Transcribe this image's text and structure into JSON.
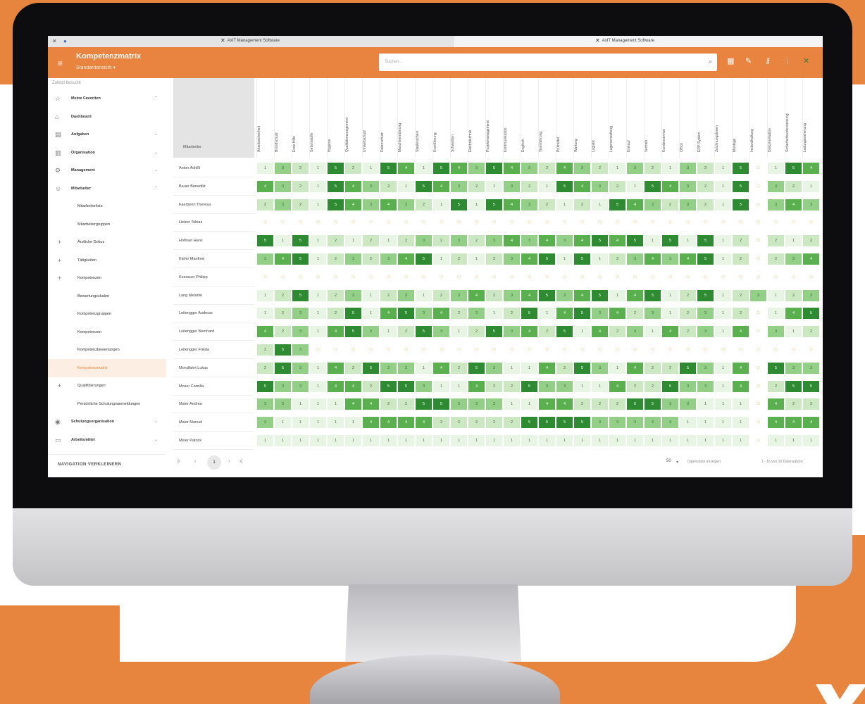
{
  "window": {
    "tab_left_title": "AxIT Management Software",
    "tab_right_title": "AxIT Management Software"
  },
  "appbar": {
    "title": "Kompetenzmatrix",
    "subtitle": "Standardansicht ▾",
    "search_placeholder": "Suchen..."
  },
  "sidebar": {
    "search_label": "Zuletzt besucht",
    "items": [
      {
        "label": "Meine Favoriten",
        "icon": "star-icon",
        "chevron": "⌃"
      },
      {
        "label": "Dashboard",
        "icon": "home-icon",
        "chevron": ""
      },
      {
        "label": "Aufgaben",
        "icon": "clipboard-icon",
        "chevron": "⌄"
      },
      {
        "label": "Organisation",
        "icon": "building-icon",
        "chevron": "⌄"
      },
      {
        "label": "Management",
        "icon": "settings-icon",
        "chevron": "⌄"
      },
      {
        "label": "Mitarbeiter",
        "icon": "person-icon",
        "chevron": "⌃"
      },
      {
        "label": "Mitarbeiterliste",
        "icon": "",
        "chevron": ""
      },
      {
        "label": "Mitarbeitergruppen",
        "icon": "",
        "chevron": ""
      },
      {
        "label": "Ärztliche Dokus",
        "icon": "",
        "chevron": ""
      },
      {
        "label": "Tätigkeiten",
        "icon": "",
        "chevron": ""
      },
      {
        "label": "Kompetenzen",
        "icon": "",
        "chevron": ""
      },
      {
        "label": "Bewertungsskalen",
        "icon": "",
        "chevron": ""
      },
      {
        "label": "Kompetenzgruppen",
        "icon": "",
        "chevron": ""
      },
      {
        "label": "Kompetenzen",
        "icon": "",
        "chevron": ""
      },
      {
        "label": "Kompetenzbewertungen",
        "icon": "",
        "chevron": ""
      },
      {
        "label": "Kompetenzmatrix",
        "icon": "",
        "chevron": ""
      },
      {
        "label": "Qualifizierungen",
        "icon": "",
        "chevron": ""
      },
      {
        "label": "Persönliche Schulungsanmeldungen",
        "icon": "",
        "chevron": ""
      },
      {
        "label": "Schulungsorganisation",
        "icon": "school-icon",
        "chevron": "⌄"
      },
      {
        "label": "Arbeitsmittel",
        "icon": "monitor-icon",
        "chevron": "⌄"
      }
    ],
    "collapse_label": "NAVIGATION VERKLEINERN"
  },
  "matrix": {
    "header_label": "Mitarbeiter",
    "columns": [
      "Arbeitssicherheit",
      "Brandschutz",
      "Erste Hilfe",
      "Gefahrstoffe",
      "Hygiene",
      "Qualitätsmanagement",
      "Umweltschutz",
      "Datenschutz",
      "Maschinenführung",
      "Staplerschein",
      "Kranführung",
      "Schweißen",
      "Elektrotechnik",
      "Projektmanagement",
      "Kommunikation",
      "Englisch",
      "Teamführung",
      "Prüfmittel",
      "Wartung",
      "Logistik",
      "Lagerverwaltung",
      "Einkauf",
      "Vertrieb",
      "Kundenservice",
      "Office",
      "ERP-System",
      "Zeichnungslesen",
      "Montage",
      "Instandhaltung",
      "Dokumentation",
      "Sicherheitsunterweisung",
      "Ladungssicherung"
    ],
    "employees": [
      "Anton Achilli",
      "Bauer Benedikt",
      "Faerberin Theresa",
      "Heizer Tobias",
      "Hofman Hans",
      "Kiefer Manfred",
      "Koerauer Philipp",
      "Lang Melanie",
      "Leitengger Andreas",
      "Leitengger Bernhard",
      "Leitengger Frieda",
      "Mondfahrt Lukas",
      "Moser Camilla",
      "Maier Andrea",
      "Maier Manuel",
      "Meier Patrick"
    ],
    "grades": [
      "1",
      "2",
      "3",
      "4",
      "5"
    ],
    "missing_marker": "○"
  },
  "pager": {
    "current_page": "1",
    "page_size": "50",
    "page_size_label": "Datensätze anzeigen",
    "range_label": "1 - 16 von 16 Datensätzen"
  },
  "colors": {
    "brand": "#e8843f",
    "level_1": "#e8f4e4",
    "level_2": "#cbe8c3",
    "level_3": "#93cf86",
    "level_4": "#5aaf4f",
    "level_5": "#2e8b32",
    "missing": "#f0c97a"
  }
}
